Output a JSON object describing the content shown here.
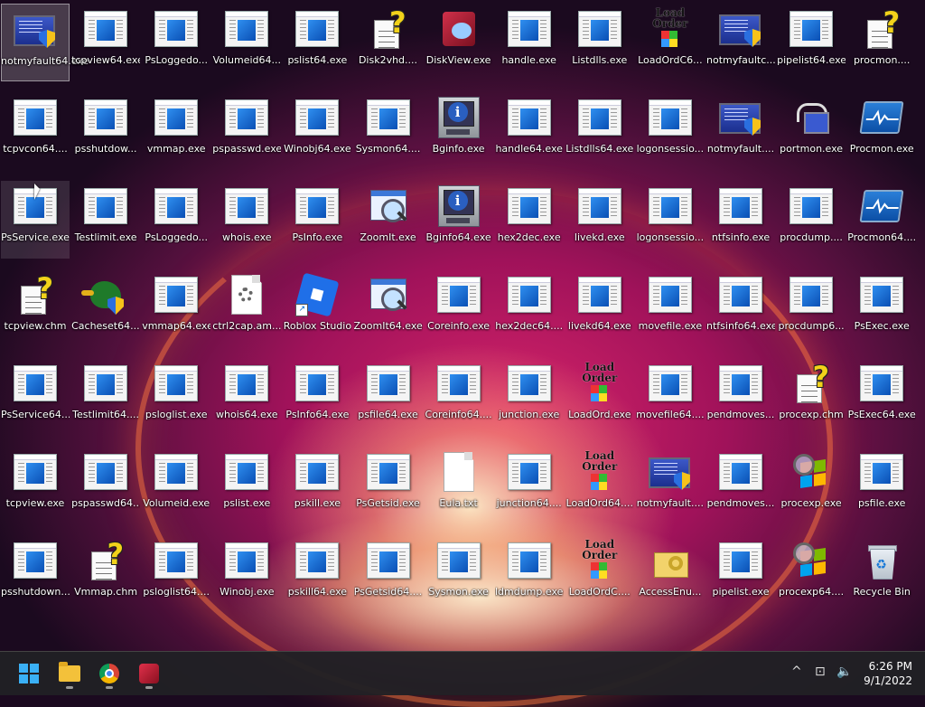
{
  "desktop": {
    "icons": [
      {
        "label": "notmyfault64.exe",
        "type": "monitor-shield",
        "selected": true
      },
      {
        "label": "tcpview64.exe",
        "type": "exe"
      },
      {
        "label": "PsLoggedo...",
        "type": "exe"
      },
      {
        "label": "Volumeid64...",
        "type": "exe"
      },
      {
        "label": "pslist64.exe",
        "type": "exe"
      },
      {
        "label": "Disk2vhd....",
        "type": "chm"
      },
      {
        "label": "DiskView.exe",
        "type": "disk"
      },
      {
        "label": "handle.exe",
        "type": "exe"
      },
      {
        "label": "Listdlls.exe",
        "type": "exe"
      },
      {
        "label": "LoadOrdC6...",
        "type": "loadord"
      },
      {
        "label": "notmyfaultc...",
        "type": "monitor-shield"
      },
      {
        "label": "pipelist64.exe",
        "type": "exe"
      },
      {
        "label": "procmon....",
        "type": "chm"
      },
      {
        "label": "tcpvcon64....",
        "type": "exe"
      },
      {
        "label": "psshutdow...",
        "type": "exe"
      },
      {
        "label": "vmmap.exe",
        "type": "exe"
      },
      {
        "label": "pspasswd.exe",
        "type": "exe"
      },
      {
        "label": "Winobj64.exe",
        "type": "exe"
      },
      {
        "label": "Sysmon64....",
        "type": "exe"
      },
      {
        "label": "Bginfo.exe",
        "type": "bginfo"
      },
      {
        "label": "handle64.exe",
        "type": "exe"
      },
      {
        "label": "Listdlls64.exe",
        "type": "exe"
      },
      {
        "label": "logonsessio...",
        "type": "exe"
      },
      {
        "label": "notmyfault....",
        "type": "monitor-shield"
      },
      {
        "label": "portmon.exe",
        "type": "portmon"
      },
      {
        "label": "Procmon.exe",
        "type": "procmon"
      },
      {
        "label": "PsService.exe",
        "type": "exe",
        "hover": true
      },
      {
        "label": "Testlimit.exe",
        "type": "exe"
      },
      {
        "label": "PsLoggedo...",
        "type": "exe"
      },
      {
        "label": "whois.exe",
        "type": "exe"
      },
      {
        "label": "PsInfo.exe",
        "type": "exe"
      },
      {
        "label": "ZoomIt.exe",
        "type": "zoom"
      },
      {
        "label": "Bginfo64.exe",
        "type": "bginfo"
      },
      {
        "label": "hex2dec.exe",
        "type": "exe"
      },
      {
        "label": "livekd.exe",
        "type": "exe"
      },
      {
        "label": "logonsessio...",
        "type": "exe"
      },
      {
        "label": "ntfsinfo.exe",
        "type": "exe"
      },
      {
        "label": "procdump....",
        "type": "exe"
      },
      {
        "label": "Procmon64....",
        "type": "procmon"
      },
      {
        "label": "tcpview.chm",
        "type": "chm"
      },
      {
        "label": "Cacheset64....",
        "type": "duck"
      },
      {
        "label": "vmmap64.exe",
        "type": "exe"
      },
      {
        "label": "ctrl2cap.am...",
        "type": "cfg"
      },
      {
        "label": "Roblox Studio",
        "type": "roblox"
      },
      {
        "label": "ZoomIt64.exe",
        "type": "zoom"
      },
      {
        "label": "Coreinfo.exe",
        "type": "exe"
      },
      {
        "label": "hex2dec64....",
        "type": "exe"
      },
      {
        "label": "livekd64.exe",
        "type": "exe"
      },
      {
        "label": "movefile.exe",
        "type": "exe"
      },
      {
        "label": "ntfsinfo64.exe",
        "type": "exe"
      },
      {
        "label": "procdump6...",
        "type": "exe"
      },
      {
        "label": "PsExec.exe",
        "type": "exe"
      },
      {
        "label": "PsService64...",
        "type": "exe"
      },
      {
        "label": "Testlimit64....",
        "type": "exe"
      },
      {
        "label": "psloglist.exe",
        "type": "exe"
      },
      {
        "label": "whois64.exe",
        "type": "exe"
      },
      {
        "label": "PsInfo64.exe",
        "type": "exe"
      },
      {
        "label": "psfile64.exe",
        "type": "exe"
      },
      {
        "label": "Coreinfo64....",
        "type": "exe"
      },
      {
        "label": "junction.exe",
        "type": "exe"
      },
      {
        "label": "LoadOrd.exe",
        "type": "loadord"
      },
      {
        "label": "movefile64....",
        "type": "exe"
      },
      {
        "label": "pendmoves...",
        "type": "exe"
      },
      {
        "label": "procexp.chm",
        "type": "chm"
      },
      {
        "label": "PsExec64.exe",
        "type": "exe"
      },
      {
        "label": "tcpview.exe",
        "type": "exe"
      },
      {
        "label": "pspasswd64....",
        "type": "exe"
      },
      {
        "label": "Volumeid.exe",
        "type": "exe"
      },
      {
        "label": "pslist.exe",
        "type": "exe"
      },
      {
        "label": "pskill.exe",
        "type": "exe"
      },
      {
        "label": "PsGetsid.exe",
        "type": "exe"
      },
      {
        "label": "Eula.txt",
        "type": "doc"
      },
      {
        "label": "junction64....",
        "type": "exe"
      },
      {
        "label": "LoadOrd64....",
        "type": "loadord"
      },
      {
        "label": "notmyfault....",
        "type": "monitor-shield"
      },
      {
        "label": "pendmoves...",
        "type": "exe"
      },
      {
        "label": "procexp.exe",
        "type": "procexp"
      },
      {
        "label": "psfile.exe",
        "type": "exe"
      },
      {
        "label": "psshutdown...",
        "type": "exe"
      },
      {
        "label": "Vmmap.chm",
        "type": "chm"
      },
      {
        "label": "psloglist64....",
        "type": "exe"
      },
      {
        "label": "Winobj.exe",
        "type": "exe"
      },
      {
        "label": "pskill64.exe",
        "type": "exe"
      },
      {
        "label": "PsGetsid64....",
        "type": "exe"
      },
      {
        "label": "Sysmon.exe",
        "type": "exe"
      },
      {
        "label": "ldmdump.exe",
        "type": "exe"
      },
      {
        "label": "LoadOrdC....",
        "type": "loadord"
      },
      {
        "label": "AccessEnu...",
        "type": "access"
      },
      {
        "label": "pipelist.exe",
        "type": "exe"
      },
      {
        "label": "procexp64....",
        "type": "procexp"
      },
      {
        "label": "Recycle Bin",
        "type": "bin"
      }
    ],
    "loadord_text": [
      "Load",
      "Order"
    ]
  },
  "taskbar": {
    "pinned": [
      {
        "name": "start-button",
        "icon": "windows-start-icon"
      },
      {
        "name": "file-explorer-button",
        "icon": "folder-icon"
      },
      {
        "name": "chrome-button",
        "icon": "chrome-icon"
      },
      {
        "name": "diskview-button",
        "icon": "diskview-icon"
      }
    ],
    "tray": {
      "chevron": "^",
      "network": "⊡",
      "volume": "🔈"
    },
    "clock": {
      "time": "6:26 PM",
      "date": "9/1/2022"
    }
  },
  "colors": {
    "accent": "#3ab0f6",
    "taskbar": "#202024"
  }
}
